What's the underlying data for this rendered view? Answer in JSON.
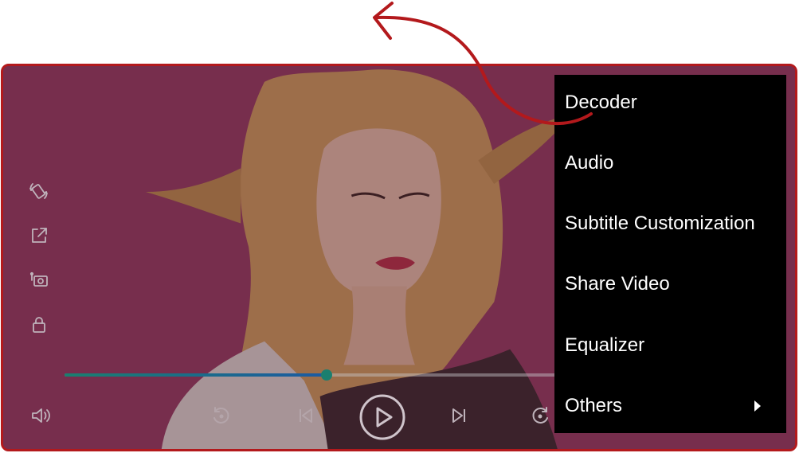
{
  "player": {
    "progress": 0.53,
    "icons": {
      "rotate": "screen-rotate-icon",
      "popout": "popout-window-icon",
      "background_play": "background-play-icon",
      "lock": "lock-icon",
      "volume": "volume-icon",
      "rewind": "rewind-icon",
      "previous": "previous-icon",
      "play": "play-icon",
      "next": "next-icon",
      "forward": "fast-forward-icon"
    }
  },
  "menu": {
    "items": [
      {
        "label": "Decoder"
      },
      {
        "label": "Audio"
      },
      {
        "label": "Subtitle Customization"
      },
      {
        "label": "Share Video"
      },
      {
        "label": "Equalizer"
      },
      {
        "label": "Others",
        "has_submenu": true
      }
    ]
  },
  "colors": {
    "annotation": "#b3191c",
    "background": "#6e2a4a",
    "menu": "#000000",
    "seek_start": "#1a7f6f",
    "seek_end": "#1b5aa3"
  }
}
